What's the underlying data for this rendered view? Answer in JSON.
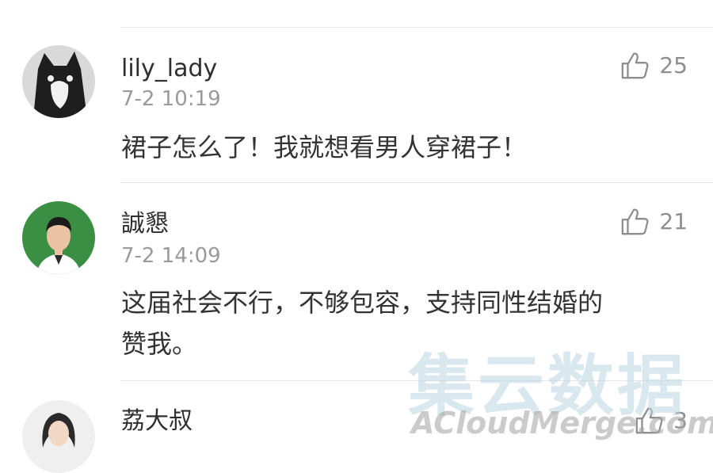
{
  "top_partial_text": "······",
  "comments": [
    {
      "username": "lily_lady",
      "time": "7-2 10:19",
      "likes": "25",
      "text": "裙子怎么了！我就想看男人穿裙子！"
    },
    {
      "username": "誠懇",
      "time": "7-2 14:09",
      "likes": "21",
      "text_line1": "这届社会不行，不够包容，支持同性结婚的",
      "text_line2": "赞我。"
    },
    {
      "username": "荔大叔",
      "likes": "3"
    }
  ],
  "watermark": {
    "cn": "集云数据",
    "en": "ACloudMerge.com"
  },
  "icons": {
    "like": "thumbs-up-icon"
  }
}
